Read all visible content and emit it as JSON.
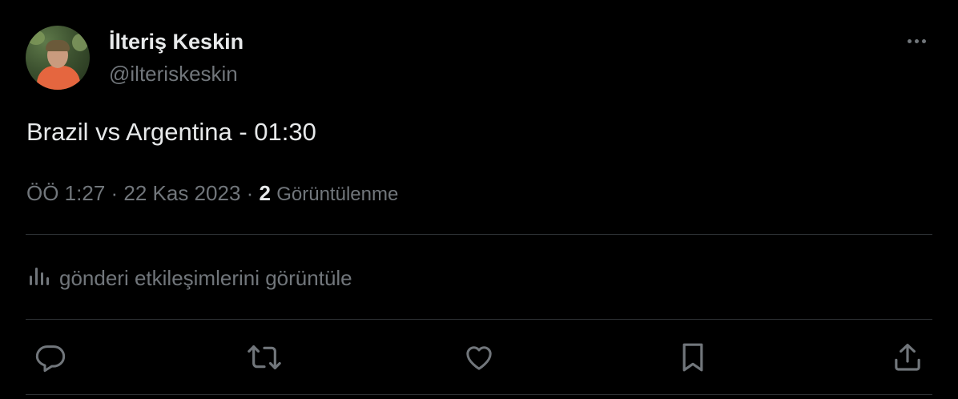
{
  "author": {
    "display_name": "İlteriş Keskin",
    "handle": "@ilteriskeskin",
    "avatar_icon": "profile-photo"
  },
  "menu": {
    "more_icon": "more-horizontal-icon"
  },
  "tweet": {
    "text": "Brazil vs Argentina - 01:30"
  },
  "meta": {
    "time": "ÖÖ 1:27",
    "separator1": " · ",
    "date": "22 Kas 2023",
    "separator2": " · ",
    "view_count": "2",
    "views_label": "Görüntülenme"
  },
  "analytics": {
    "icon": "bar-chart-icon",
    "label": "gönderi etkileşimlerini görüntüle"
  },
  "actions": [
    {
      "icon": "reply-icon"
    },
    {
      "icon": "retweet-icon"
    },
    {
      "icon": "like-icon"
    },
    {
      "icon": "bookmark-icon"
    },
    {
      "icon": "share-icon"
    }
  ],
  "colors": {
    "background": "#000000",
    "primary_text": "#e7e9ea",
    "secondary_text": "#71767b",
    "divider": "#2f3336"
  }
}
